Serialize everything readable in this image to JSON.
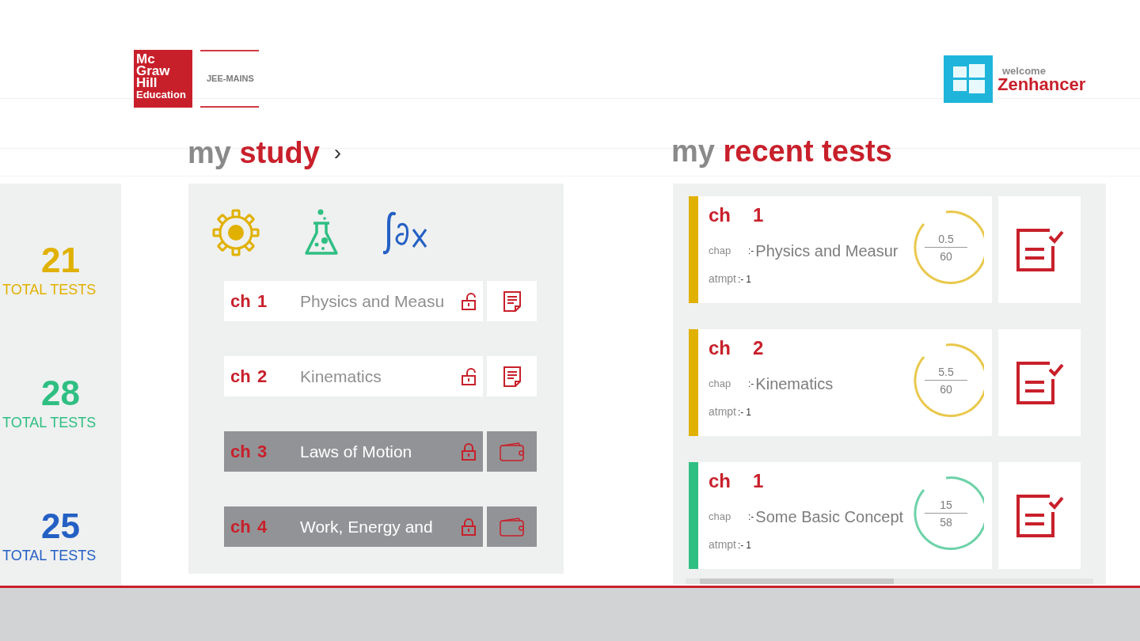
{
  "header": {
    "logo_lines": [
      "Mc",
      "Graw",
      "Hill",
      "Education"
    ],
    "exam": "JEE-MAINS",
    "welcome": "welcome",
    "user": "Zenhancer"
  },
  "stats": [
    {
      "value": "21",
      "label": "TOTAL TESTS",
      "color": "#e0b100"
    },
    {
      "value": "28",
      "label": "TOTAL TESTS",
      "color": "#2fbf83"
    },
    {
      "value": "25",
      "label": "TOTAL TESTS",
      "color": "#2460c4"
    }
  ],
  "study": {
    "heading_prefix": "my",
    "heading": "study",
    "chevron": "›",
    "subjects": [
      {
        "kind": "gear",
        "color": "#e0b100"
      },
      {
        "kind": "flask",
        "color": "#2fbf83"
      },
      {
        "kind": "integral",
        "color": "#2460c4"
      }
    ],
    "chapters": [
      {
        "prefix": "ch",
        "number": "1",
        "title": "Physics and Measu",
        "locked": false
      },
      {
        "prefix": "ch",
        "number": "2",
        "title": "Kinematics",
        "locked": false
      },
      {
        "prefix": "ch",
        "number": "3",
        "title": "Laws of Motion",
        "locked": true
      },
      {
        "prefix": "ch",
        "number": "4",
        "title": "Work, Energy and",
        "locked": true
      }
    ]
  },
  "recent": {
    "heading_prefix": "my",
    "heading": "recent tests",
    "tests": [
      {
        "prefix": "ch",
        "number": "1",
        "chap_label": "chap",
        "separator": ":-",
        "title": "Physics and Measur",
        "attempt_label": "atmpt",
        "attempt_separator": ":-",
        "attempt": "1",
        "score": "0.5",
        "total": "60",
        "color": "#e0b100"
      },
      {
        "prefix": "ch",
        "number": "2",
        "chap_label": "chap",
        "separator": ":-",
        "title": "Kinematics",
        "attempt_label": "atmpt",
        "attempt_separator": ":-",
        "attempt": "1",
        "score": "5.5",
        "total": "60",
        "color": "#e0b100"
      },
      {
        "prefix": "ch",
        "number": "1",
        "chap_label": "chap",
        "separator": ":-",
        "title": "Some Basic Concept",
        "attempt_label": "atmpt",
        "attempt_separator": ":-",
        "attempt": "1",
        "score": "15",
        "total": "58",
        "color": "#2fbf83"
      }
    ]
  }
}
